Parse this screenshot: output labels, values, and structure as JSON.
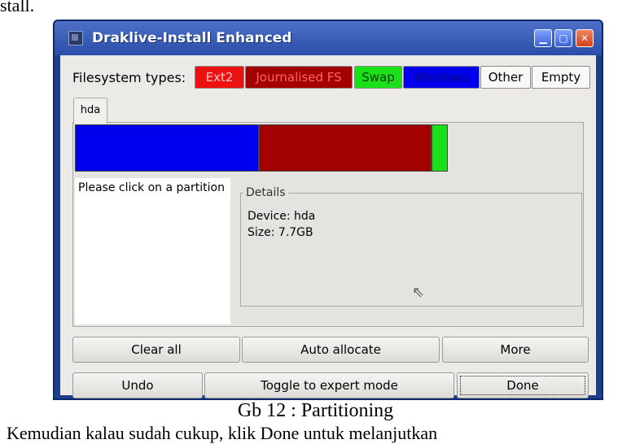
{
  "document": {
    "top_text": "stall.",
    "caption": "Gb 12 : Partitioning",
    "bottom_text": "Kemudian kalau sudah cukup, klik Done untuk melanjutkan"
  },
  "window": {
    "title": "Draklive-Install Enhanced",
    "controls": {
      "minimize": "▁",
      "maximize": "▢",
      "close": "✕"
    }
  },
  "filesystem": {
    "label": "Filesystem types:",
    "types": [
      {
        "label": "Ext2",
        "color": "#ee1111"
      },
      {
        "label": "Journalised FS",
        "color": "#a30000"
      },
      {
        "label": "Swap",
        "color": "#19e019"
      },
      {
        "label": "Windows",
        "color": "#0000ee"
      },
      {
        "label": "Other",
        "color": "#f8f8f6"
      },
      {
        "label": "Empty",
        "color": "#f8f8f6"
      }
    ]
  },
  "disk": {
    "tab": "hda",
    "partitions": [
      {
        "type": "Windows",
        "color": "#0000ee"
      },
      {
        "type": "Journalised FS",
        "color": "#a30000"
      },
      {
        "type": "Swap",
        "color": "#19e019"
      }
    ]
  },
  "info": {
    "message": "Please click on a partition"
  },
  "details": {
    "legend": "Details",
    "device": "Device: hda",
    "size": "Size: 7.7GB"
  },
  "buttons": {
    "clear_all": "Clear all",
    "auto_allocate": "Auto allocate",
    "more": "More",
    "undo": "Undo",
    "toggle_expert": "Toggle to expert mode",
    "done": "Done"
  }
}
